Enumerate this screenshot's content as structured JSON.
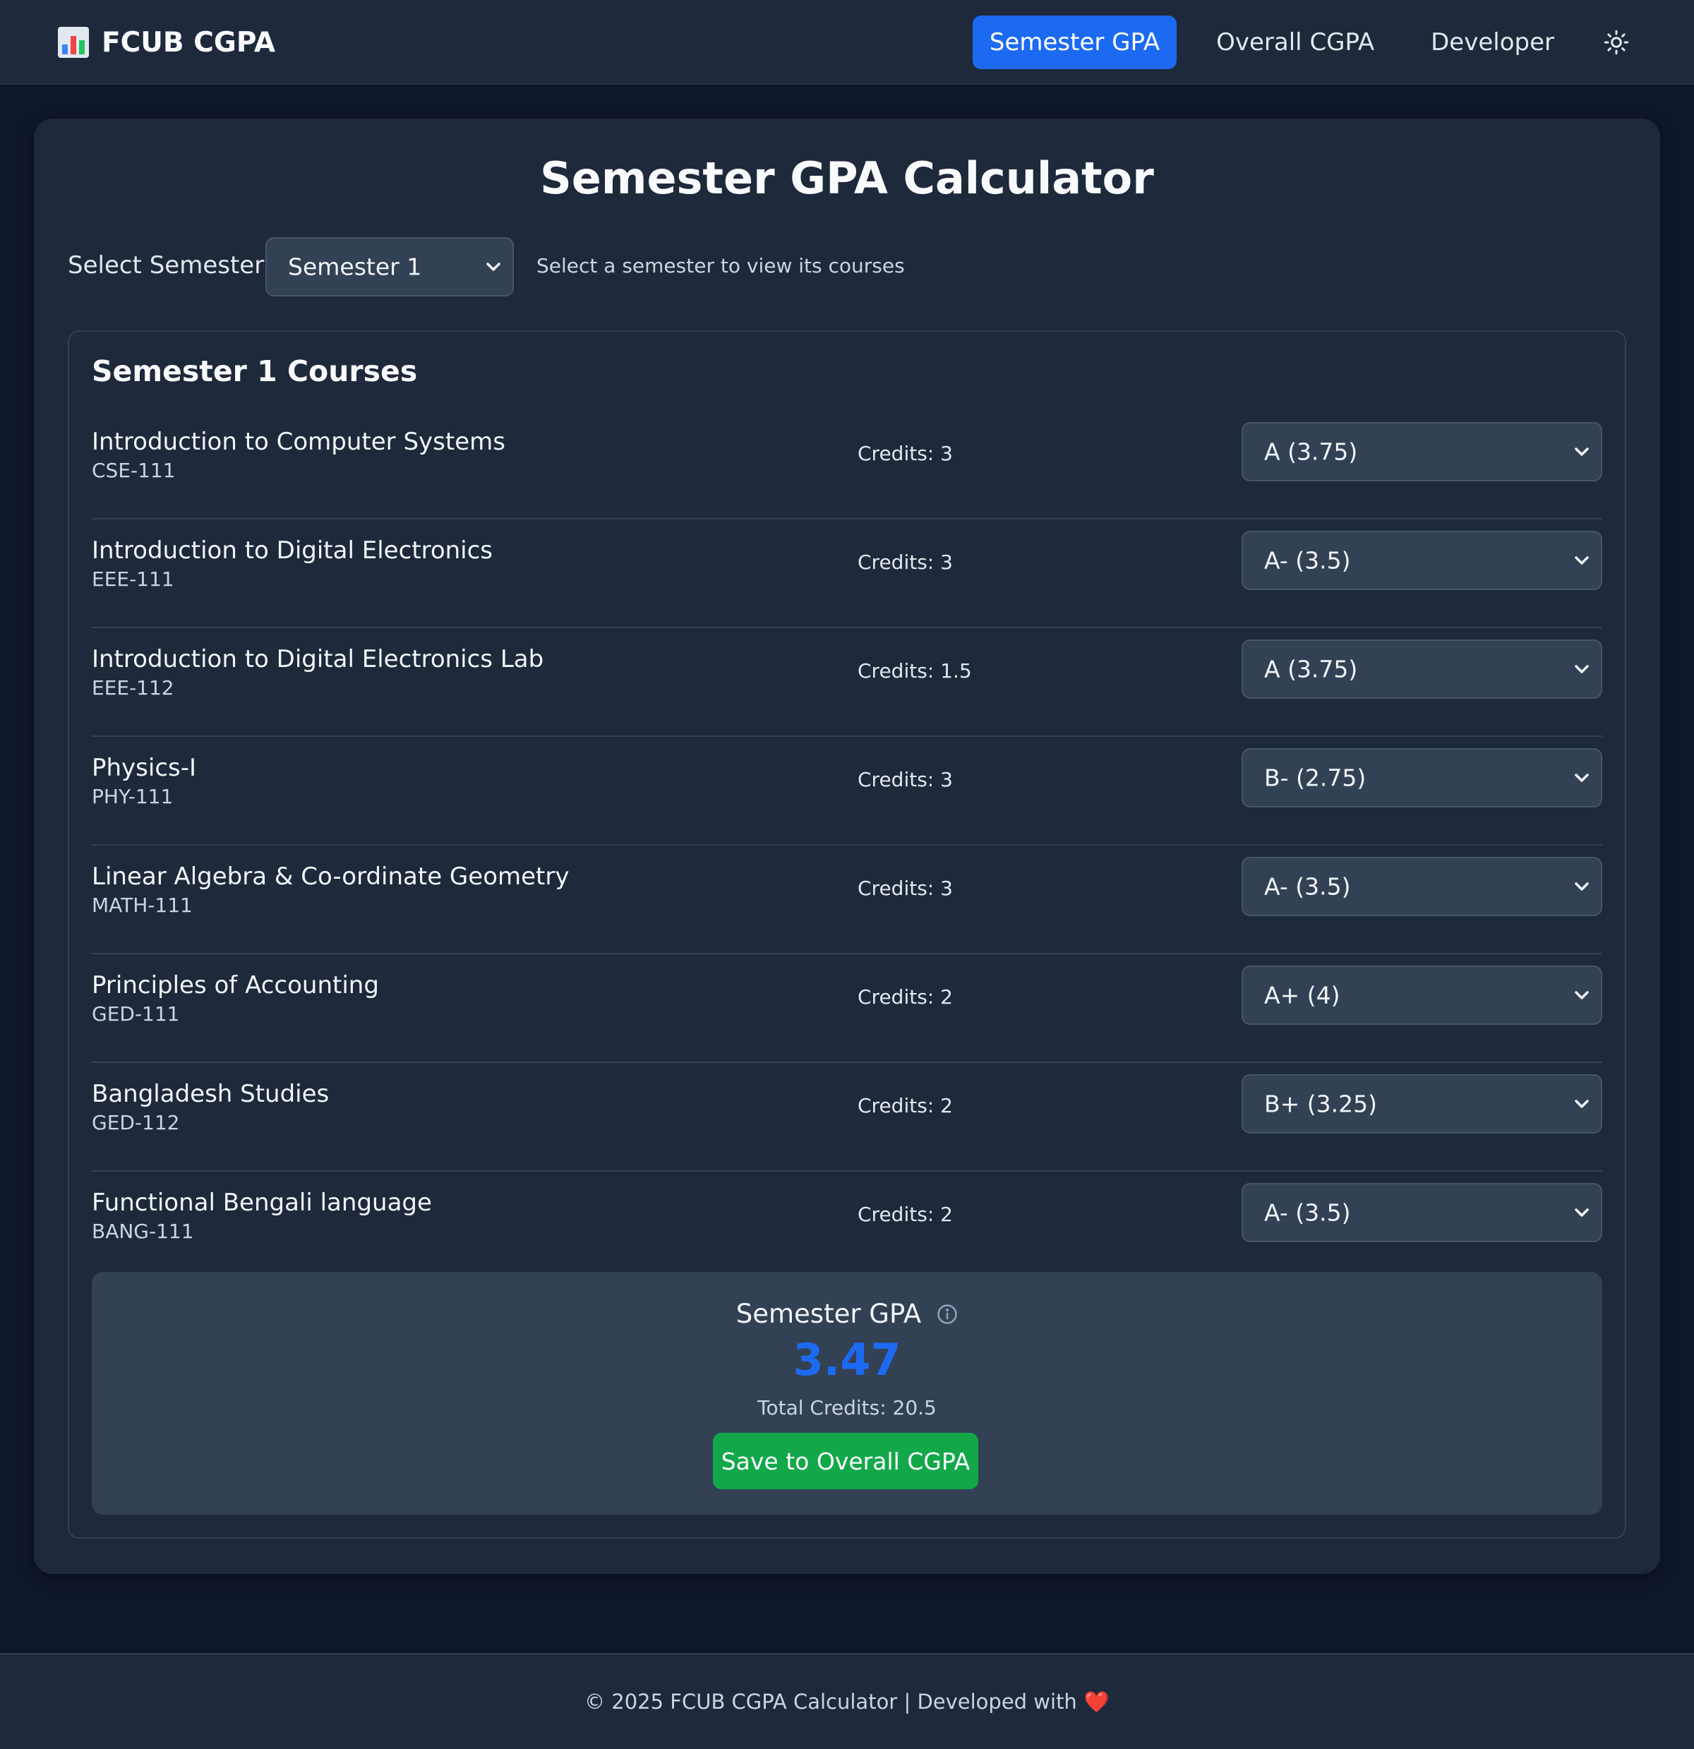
{
  "header": {
    "brand_icon": "bar-chart-icon",
    "brand_title": "FCUB CGPA",
    "tabs": [
      {
        "label": "Semester GPA",
        "active": true
      },
      {
        "label": "Overall CGPA",
        "active": false
      },
      {
        "label": "Developer",
        "active": false
      }
    ],
    "theme_icon": "sun-icon"
  },
  "colors": {
    "accent": "#1d6af2",
    "save_button": "#12a84a",
    "background": "#0f172a",
    "card": "#1e293b",
    "heart": "#e11d48"
  },
  "calculator": {
    "title": "Semester GPA Calculator",
    "semester_label": "Select Semester:",
    "semester_selected": "Semester 1",
    "semester_hint": "Select a semester to view its courses",
    "courses_heading": "Semester 1 Courses",
    "courses": [
      {
        "name": "Introduction to Computer Systems",
        "code": "CSE-111",
        "credits": "Credits: 3",
        "grade": "A (3.75)"
      },
      {
        "name": "Introduction to Digital Electronics",
        "code": "EEE-111",
        "credits": "Credits: 3",
        "grade": "A- (3.5)"
      },
      {
        "name": "Introduction to Digital Electronics Lab",
        "code": "EEE-112",
        "credits": "Credits: 1.5",
        "grade": "A (3.75)"
      },
      {
        "name": "Physics-I",
        "code": "PHY-111",
        "credits": "Credits: 3",
        "grade": "B- (2.75)"
      },
      {
        "name": "Linear Algebra & Co-ordinate Geometry",
        "code": "MATH-111",
        "credits": "Credits: 3",
        "grade": "A- (3.5)"
      },
      {
        "name": "Principles of Accounting",
        "code": "GED-111",
        "credits": "Credits: 2",
        "grade": "A+ (4)"
      },
      {
        "name": "Bangladesh Studies",
        "code": "GED-112",
        "credits": "Credits: 2",
        "grade": "B+ (3.25)"
      },
      {
        "name": "Functional Bengali language",
        "code": "BANG-111",
        "credits": "Credits: 2",
        "grade": "A- (3.5)"
      }
    ],
    "result": {
      "label": "Semester GPA",
      "info_icon": "info-icon",
      "gpa": "3.47",
      "total_credits": "Total Credits: 20.5",
      "save_label": "Save to Overall CGPA"
    }
  },
  "footer": {
    "text": "© 2025 FCUB CGPA Calculator | Developed with",
    "heart": "❤️"
  }
}
